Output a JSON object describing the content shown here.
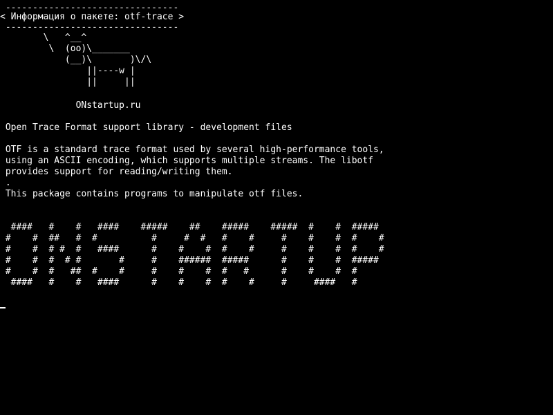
{
  "header": {
    "rule_top": " --------------------------------",
    "title": "< Информация о пакете: otf-trace >",
    "rule_bottom": " --------------------------------"
  },
  "cowsay": {
    "lines": [
      "        \\   ^__^",
      "         \\  (oo)\\_______",
      "            (__)\\       )\\/\\",
      "                ||----w |",
      "                ||     ||"
    ],
    "caption": "              ONstartup.ru"
  },
  "package": {
    "summary": " Open Trace Format support library - development files",
    "description": [
      " OTF is a standard trace format used by several high-performance tools,",
      " using an ASCII encoding, which supports multiple streams. The libotf",
      " provides support for reading/writing them.",
      " .",
      " This package contains programs to manipulate otf files."
    ]
  },
  "banner": {
    "lines": [
      "  ####   #    #   ####    #####    ##    #####    #####  #    #  #####",
      " #    #  ##   #  #          #     #  #   #    #     #    #    #  #    #",
      " #    #  # #  #   ####      #    #    #  #    #     #    #    #  #    #",
      " #    #  #  # #       #     #    ######  #####      #    #    #  #####",
      " #    #  #   ##  #    #     #    #    #  #   #      #    #    #  #",
      "  ####   #    #   ####      #    #    #  #    #     #     ####   #"
    ]
  },
  "colors": {
    "background": "#000000",
    "text": "#ffffff"
  }
}
